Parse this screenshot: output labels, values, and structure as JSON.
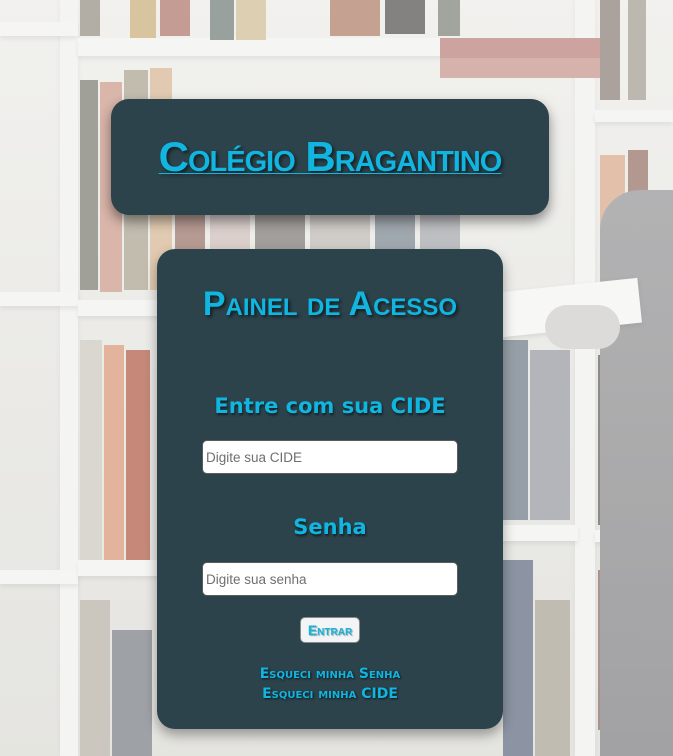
{
  "header": {
    "school_name": "Colégio Bragantino"
  },
  "login": {
    "title": "Painel de Acesso",
    "cide_label": "Entre com sua CIDE",
    "cide_placeholder": "Digite sua CIDE",
    "password_label": "Senha",
    "password_placeholder": "Digite sua senha",
    "submit_label": "Entrar",
    "forgot_password_link": "Esqueci minha Senha",
    "forgot_cide_link": "Esqueci minha CIDE"
  },
  "colors": {
    "card_background": "#2c434c",
    "accent": "#10b5e0"
  }
}
